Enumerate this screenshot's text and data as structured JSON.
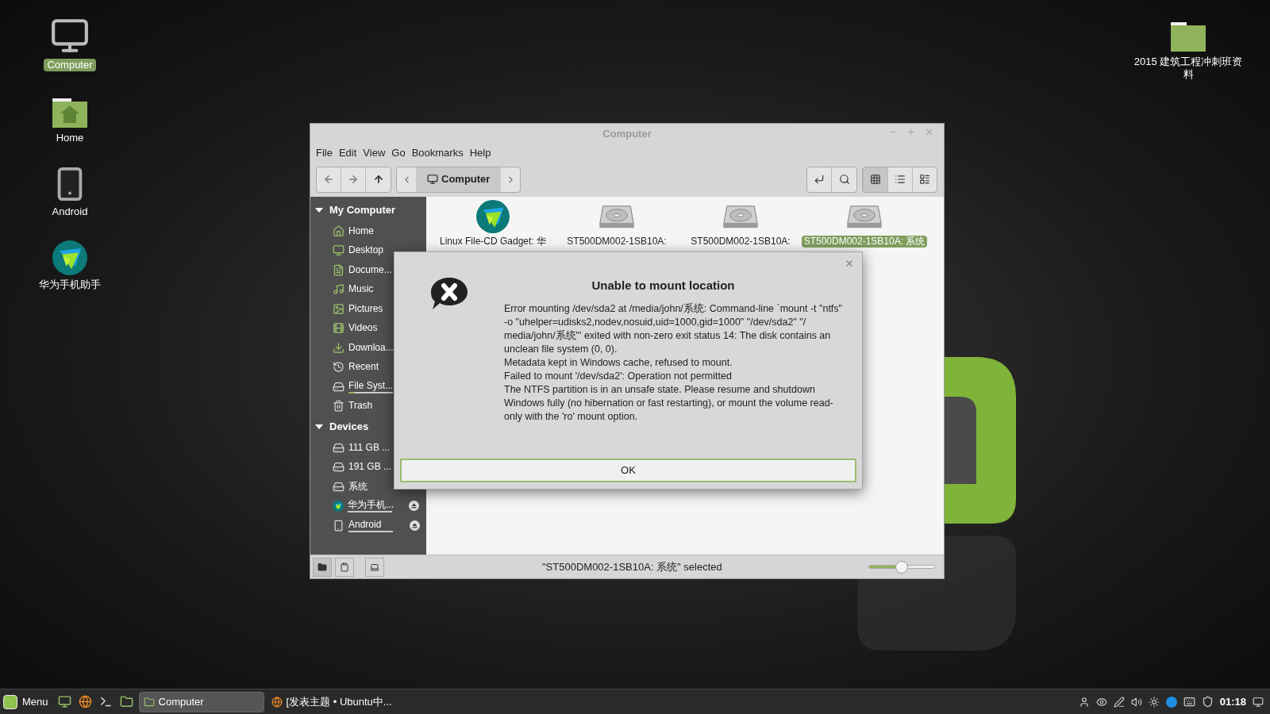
{
  "desktop_icons": [
    {
      "kind": "monitor",
      "label": "Computer",
      "selected": true
    },
    {
      "kind": "home",
      "label": "Home",
      "selected": false
    },
    {
      "kind": "phone",
      "label": "Android",
      "selected": false
    },
    {
      "kind": "app",
      "label": "华为手机助手",
      "selected": false
    }
  ],
  "desktop_icons_right": [
    {
      "kind": "folder",
      "label": "2015 建筑工程冲刺班资料",
      "selected": false
    }
  ],
  "window": {
    "title": "Computer",
    "menu": [
      "File",
      "Edit",
      "View",
      "Go",
      "Bookmarks",
      "Help"
    ],
    "location": "Computer",
    "view_buttons": [
      {
        "kind": "icons",
        "selected": true
      },
      {
        "kind": "list",
        "selected": false
      },
      {
        "kind": "compact",
        "selected": false
      }
    ],
    "sidebar": [
      {
        "title": "My Computer",
        "expanded": true,
        "items": [
          {
            "kind": "home",
            "label": "Home"
          },
          {
            "kind": "desktop",
            "label": "Desktop"
          },
          {
            "kind": "documents",
            "label": "Docume..."
          },
          {
            "kind": "music",
            "label": "Music"
          },
          {
            "kind": "pictures",
            "label": "Pictures"
          },
          {
            "kind": "videos",
            "label": "Videos"
          },
          {
            "kind": "downloads",
            "label": "Downloa..."
          },
          {
            "kind": "recent",
            "label": "Recent"
          },
          {
            "kind": "drive",
            "label": "File Syst...",
            "level": 0.12
          },
          {
            "kind": "trash",
            "label": "Trash"
          }
        ]
      },
      {
        "title": "Devices",
        "expanded": true,
        "items": [
          {
            "kind": "drive",
            "label": "111 GB ..."
          },
          {
            "kind": "drive",
            "label": "191 GB ..."
          },
          {
            "kind": "drive",
            "label": "系统"
          },
          {
            "kind": "app",
            "label": "华为手机...",
            "mounted": true,
            "eject": true
          },
          {
            "kind": "phone",
            "label": "Android",
            "mounted": true,
            "eject": true
          }
        ]
      }
    ],
    "files": [
      {
        "kind": "app",
        "label": "Linux File-CD Gadget: 华",
        "selected": false
      },
      {
        "kind": "drive",
        "label": "ST500DM002-1SB10A:",
        "selected": false
      },
      {
        "kind": "drive",
        "label": "ST500DM002-1SB10A:",
        "selected": false
      },
      {
        "kind": "drive",
        "label": "ST500DM002-1SB10A: 系统",
        "selected": true
      }
    ],
    "status": "\"ST500DM002-1SB10A: 系统\" selected",
    "zoom": {
      "level": 0.5
    }
  },
  "dialog": {
    "title": "Unable to mount location",
    "message": [
      "Error mounting /dev/sda2 at /media/john/系统: Command-line `mount -t \"ntfs\" -o \"uhelper=udisks2,nodev,nosuid,uid=1000,gid=1000\" \"/dev/sda2\" \"/ media/john/系统\"' exited with non-zero exit status 14: The disk contains an unclean file system (0, 0).",
      "Metadata kept in Windows cache, refused to mount.",
      "Failed to mount '/dev/sda2': Operation not permitted",
      "The NTFS partition is in an unsafe state. Please resume and shutdown Windows fully (no hibernation or fast restarting), or mount the volume read-only with the 'ro' mount option."
    ],
    "button": "OK"
  },
  "taskbar": {
    "menu": "Menu",
    "launchers": [
      {
        "kind": "desktop"
      },
      {
        "kind": "browser"
      },
      {
        "kind": "terminal"
      },
      {
        "kind": "folder"
      }
    ],
    "windows": [
      {
        "kind": "folder",
        "label": "Computer",
        "selected": true
      },
      {
        "kind": "browser",
        "label": "[发表主题 • Ubuntu中...",
        "selected": false
      }
    ],
    "clock": "01:18"
  }
}
